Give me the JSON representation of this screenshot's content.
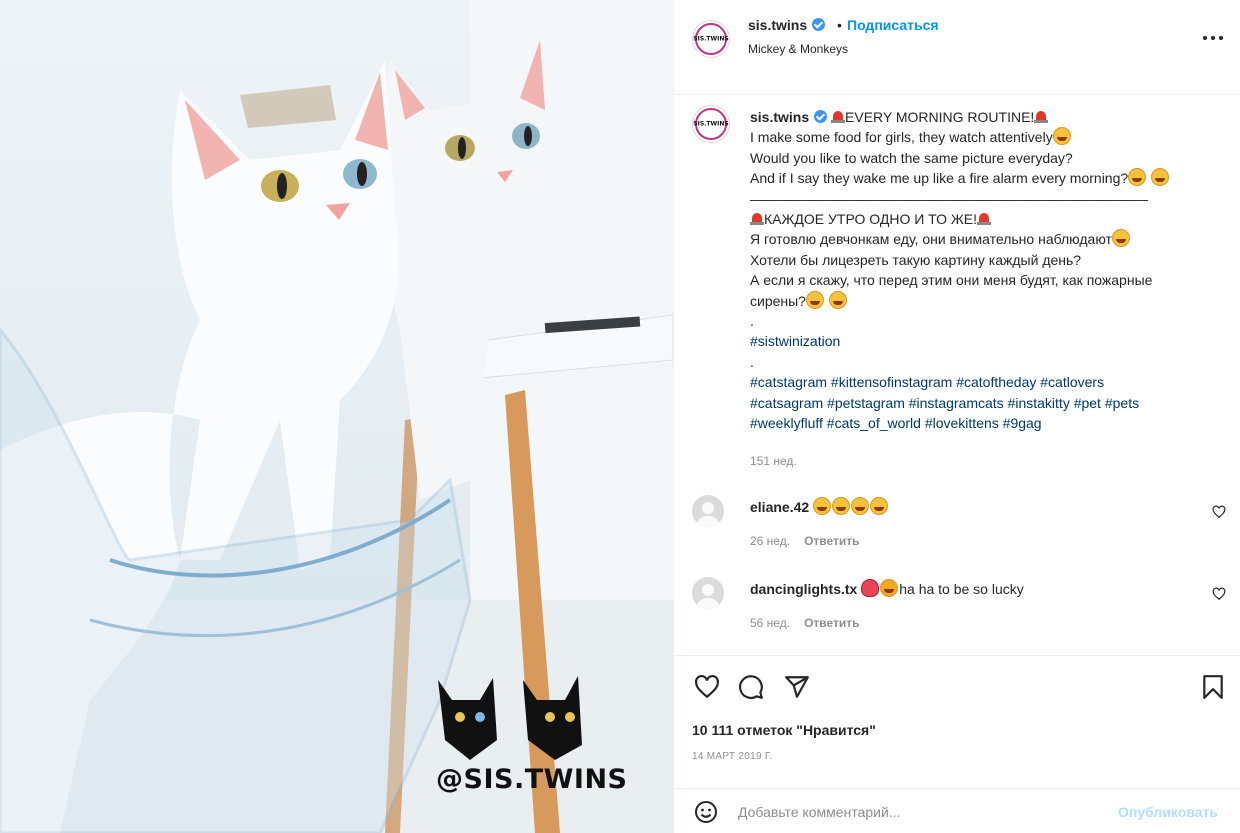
{
  "post": {
    "username": "sis.twins",
    "follow_label": "Подписаться",
    "location": "Mickey & Monkeys",
    "watermark": "@SIS.TWINS",
    "avatar_logo": "SIS.TWINS"
  },
  "caption": {
    "username": "sis.twins",
    "title": "EVERY MORNING ROUTINE!",
    "line1": "I make some food for girls, they watch attentively",
    "line2": "Would you like to watch the same picture everyday?",
    "line3": "And if I say they wake me up like a fire alarm every morning?",
    "separator": "—————————————————————————————————",
    "ru_title": "КАЖДОЕ УТРО ОДНО И ТО ЖЕ!",
    "ru1": "Я готовлю девчонкам еду, они внимательно наблюдают",
    "ru2": "Хотели бы лицезреть такую картину каждый день?",
    "ru3": "А если я скажу, что перед этим они меня будят, как пожарные",
    "ru4": "сирены?",
    "dot": ".",
    "hashtag_main": "#sistwinization",
    "tags_line1": "#catstagram #kittensofinstagram #catoftheday #catlovers",
    "tags_line2": "#catsagram #petstagram #instagramcats #instakitty #pet #pets",
    "tags_line3": "#weeklyfluff #cats_of_world #lovekittens #9gag",
    "time": "151 нед."
  },
  "comments": [
    {
      "username": "eliane.42",
      "text": "",
      "time": "26 нед.",
      "reply": "Ответить"
    },
    {
      "username": "dancinglights.tx",
      "text": "ha ha to be so lucky",
      "time": "56 нед.",
      "reply": "Ответить"
    }
  ],
  "stats": {
    "likes": "10 111 отметок \"Нравится\"",
    "date": "14 МАРТ 2019 Г."
  },
  "add_comment": {
    "placeholder": "Добавьте комментарий...",
    "publish": "Опубликовать"
  },
  "icons": [
    "verified-badge-icon",
    "more-options-icon",
    "heart-icon",
    "comment-icon",
    "share-icon",
    "bookmark-icon",
    "emoji-icon",
    "siren-emoji-icon",
    "laughing-emoji-icon",
    "heart-eyes-emoji-icon"
  ]
}
